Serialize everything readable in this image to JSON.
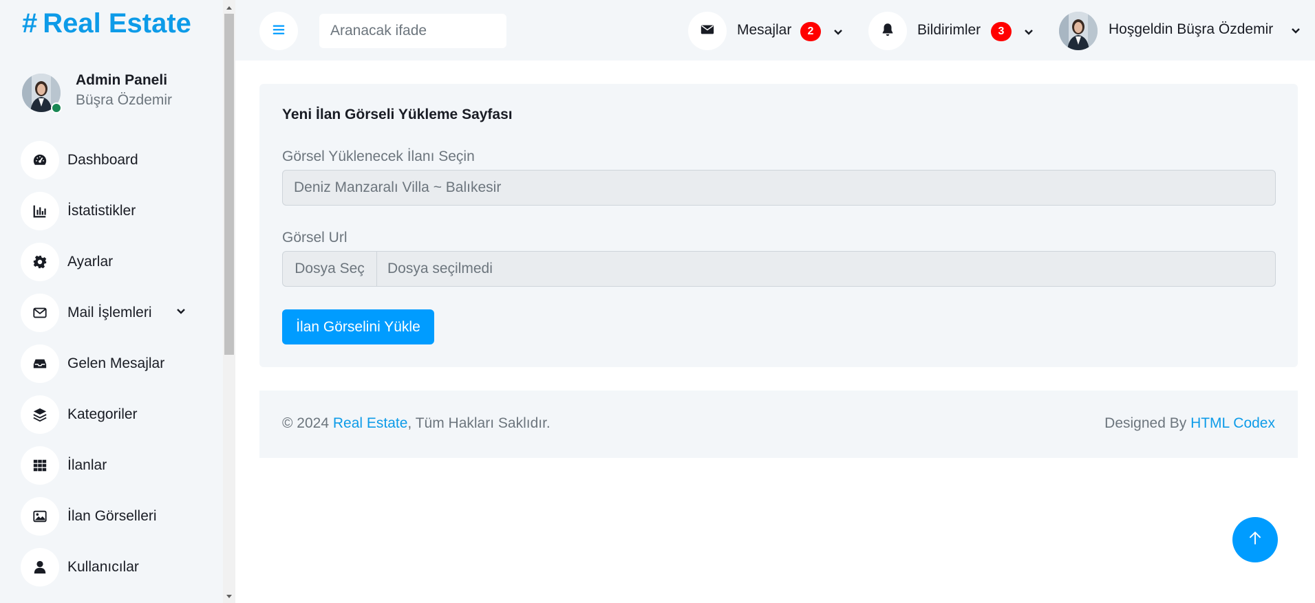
{
  "brand": {
    "hash": "#",
    "name": "Real Estate"
  },
  "admin": {
    "title": "Admin Paneli",
    "name": "Büşra Özdemir"
  },
  "sidebar": {
    "items": [
      {
        "label": "Dashboard",
        "icon": "gauge-icon"
      },
      {
        "label": "İstatistikler",
        "icon": "chart-bar-icon"
      },
      {
        "label": "Ayarlar",
        "icon": "gear-icon"
      },
      {
        "label": "Mail İşlemleri",
        "icon": "envelope-icon",
        "has_submenu": true
      },
      {
        "label": "Gelen Mesajlar",
        "icon": "inbox-icon"
      },
      {
        "label": "Kategoriler",
        "icon": "layers-icon"
      },
      {
        "label": "İlanlar",
        "icon": "grid-icon"
      },
      {
        "label": "İlan Görselleri",
        "icon": "image-icon"
      },
      {
        "label": "Kullanıcılar",
        "icon": "user-icon"
      }
    ]
  },
  "topbar": {
    "search_placeholder": "Aranacak ifade",
    "messages": {
      "label": "Mesajlar",
      "count": "2"
    },
    "notifications": {
      "label": "Bildirimler",
      "count": "3"
    },
    "user": {
      "greeting": "Hoşgeldin Büşra Özdemir"
    }
  },
  "form": {
    "title": "Yeni İlan Görseli Yükleme Sayfası",
    "listing_label": "Görsel Yüklenecek İlanı Seçin",
    "listing_value": "Deniz Manzaralı Villa ~ Balıkesir",
    "url_label": "Görsel Url",
    "file_button": "Dosya Seç",
    "file_status": "Dosya seçilmedi",
    "submit": "İlan Görselini Yükle"
  },
  "footer": {
    "copyright_prefix": "© 2024 ",
    "site_link": "Real Estate",
    "rights": ", Tüm Hakları Saklıdır.",
    "designed_by": "Designed By ",
    "designer_link": "HTML Codex"
  },
  "colors": {
    "accent": "#009cff",
    "brand": "#0d9be8",
    "badge": "#ff0000",
    "panel_bg": "#f3f6f9"
  }
}
